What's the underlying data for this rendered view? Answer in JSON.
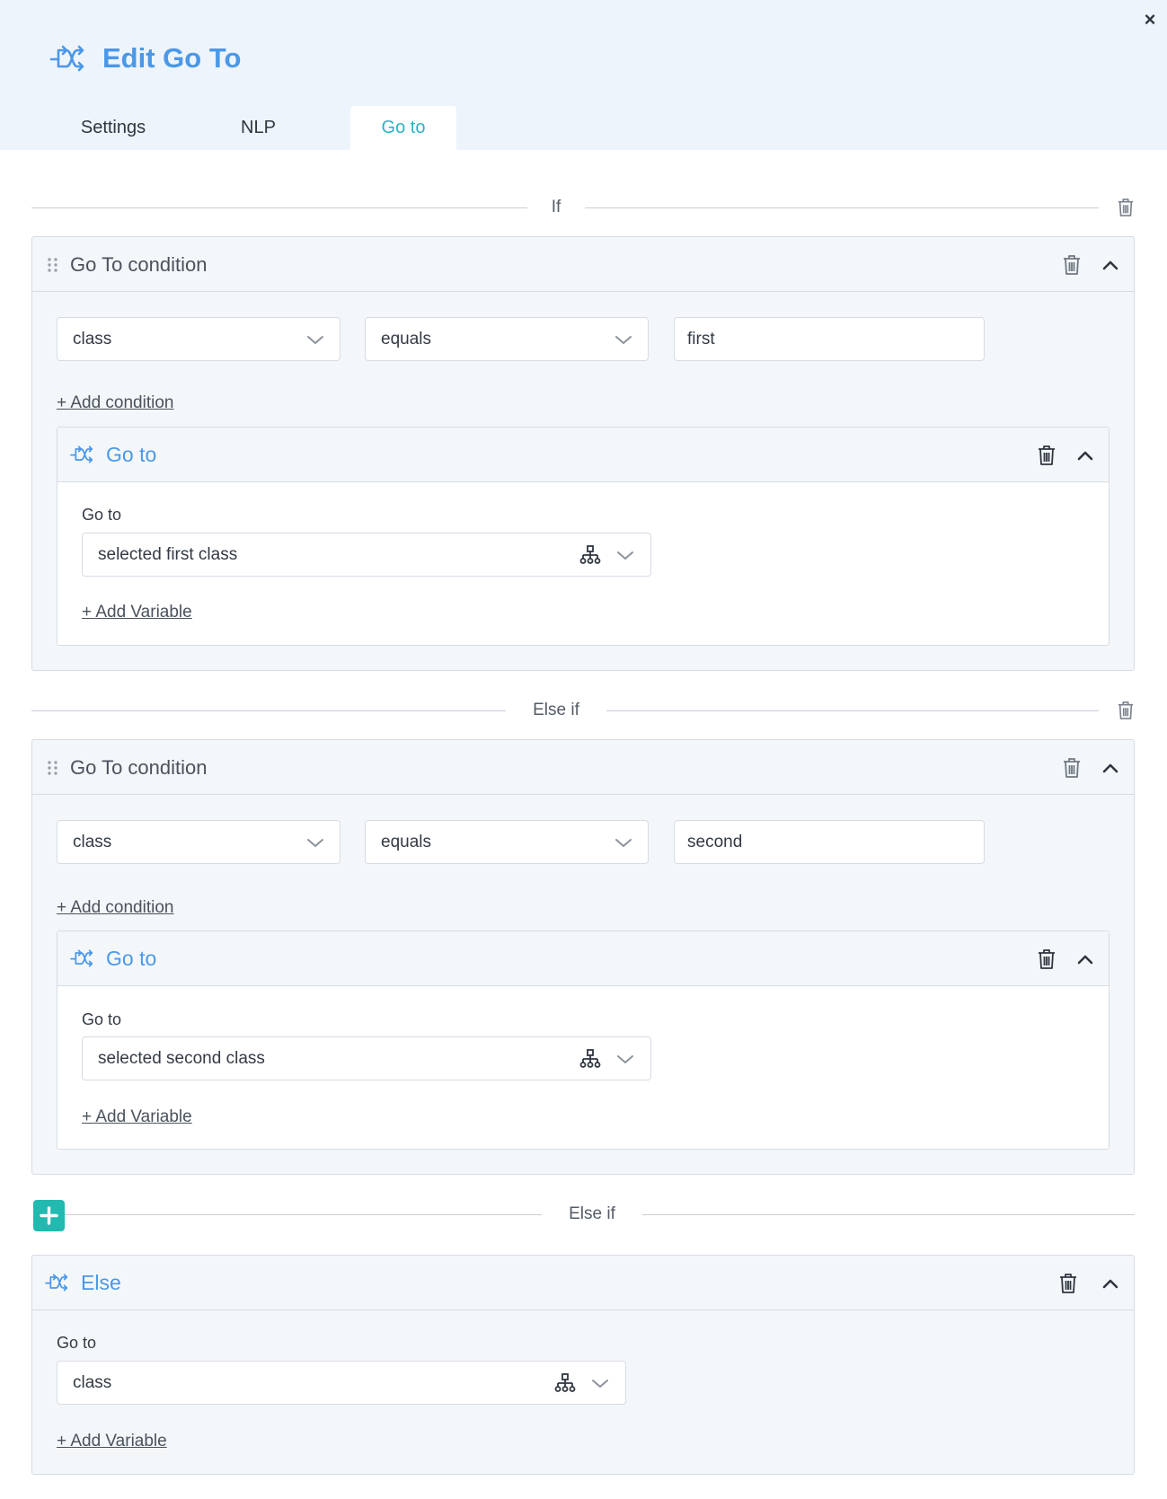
{
  "dialog": {
    "title": "Edit Go To",
    "close_label": "×"
  },
  "tabs": [
    {
      "label": "Settings"
    },
    {
      "label": "NLP"
    },
    {
      "label": "Go to",
      "active": true
    }
  ],
  "if_divider": {
    "label": "If"
  },
  "condition1": {
    "title": "Go To condition",
    "field": "class",
    "operator": "equals",
    "value": "first",
    "add_condition": "+ Add condition",
    "goto": {
      "title": "Go to",
      "label": "Go to",
      "target": "selected first class",
      "add_variable": "+ Add Variable"
    }
  },
  "elseif_divider": {
    "label": "Else if"
  },
  "condition2": {
    "title": "Go To condition",
    "field": "class",
    "operator": "equals",
    "value": "second",
    "add_condition": "+ Add condition",
    "goto": {
      "title": "Go to",
      "label": "Go to",
      "target": "selected second class",
      "add_variable": "+ Add Variable"
    }
  },
  "add_elseif_divider": {
    "label": "Else if"
  },
  "else_block": {
    "title": "Else",
    "label": "Go to",
    "target": "class",
    "add_variable": "+ Add Variable"
  },
  "colors": {
    "accent_blue": "#4a98e8",
    "accent_teal": "#2ab3c6",
    "add_button": "#22b9b0"
  },
  "icons": {
    "title": "goto-arrows-icon",
    "trash": "trash-icon",
    "chevron_up": "chevron-up-icon",
    "chevron_down": "chevron-down-icon",
    "tree": "sitemap-icon",
    "drag": "drag-handle-icon",
    "plus": "plus-icon"
  }
}
